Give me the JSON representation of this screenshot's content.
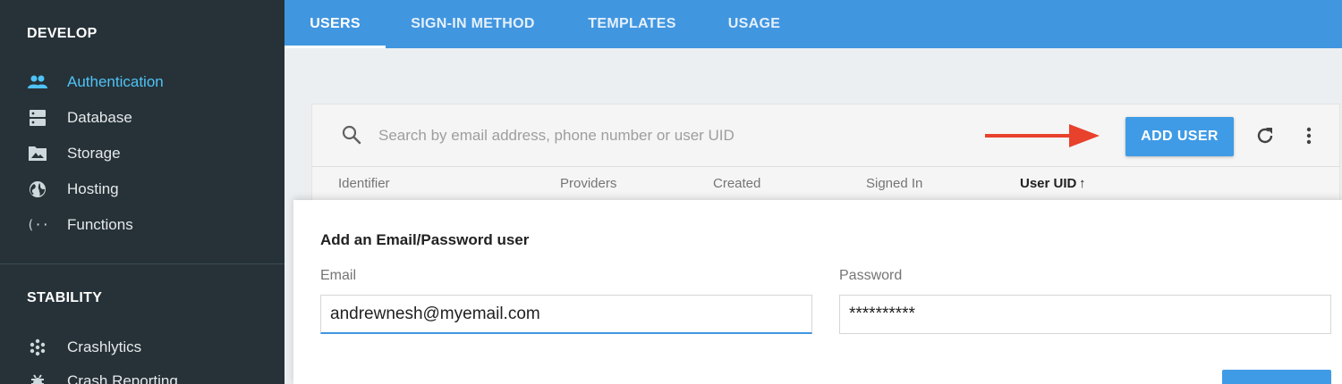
{
  "sidebar": {
    "develop_title": "DEVELOP",
    "develop_items": [
      {
        "label": "Authentication",
        "icon": "people-icon",
        "active": true
      },
      {
        "label": "Database",
        "icon": "database-icon"
      },
      {
        "label": "Storage",
        "icon": "image-icon"
      },
      {
        "label": "Hosting",
        "icon": "globe-icon"
      },
      {
        "label": "Functions",
        "icon": "functions-icon"
      }
    ],
    "stability_title": "STABILITY",
    "stability_items": [
      {
        "label": "Crashlytics",
        "icon": "crashlytics-icon"
      },
      {
        "label": "Crash Reporting",
        "icon": "bug-icon"
      }
    ]
  },
  "tabs": [
    "USERS",
    "SIGN-IN METHOD",
    "TEMPLATES",
    "USAGE"
  ],
  "users": {
    "search_placeholder": "Search by email address, phone number or user UID",
    "add_user_label": "ADD USER",
    "columns": [
      "Identifier",
      "Providers",
      "Created",
      "Signed In",
      "User UID"
    ],
    "sort_indicator": "↑"
  },
  "dialog": {
    "title": "Add an Email/Password user",
    "email_label": "Email",
    "email_value": "andrewnesh@myemail.com",
    "password_label": "Password",
    "password_value": "**********"
  },
  "colors": {
    "sidebar_bg": "#263238",
    "tab_bar": "#4196e0",
    "accent": "#3f9be6",
    "active_nav": "#4fc3f7",
    "arrow": "#e8412c"
  }
}
